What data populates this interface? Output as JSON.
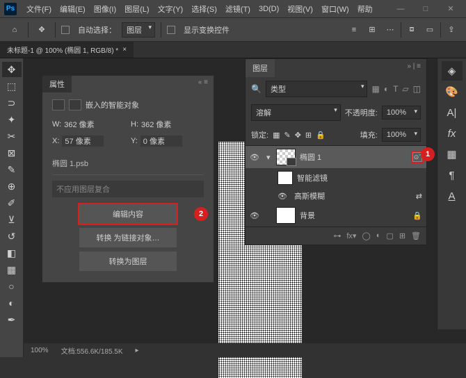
{
  "menu": [
    "文件(F)",
    "编辑(E)",
    "图像(I)",
    "图层(L)",
    "文字(Y)",
    "选择(S)",
    "滤镜(T)",
    "3D(D)",
    "视图(V)",
    "窗口(W)",
    "帮助"
  ],
  "optbar": {
    "auto_select": "自动选择：",
    "layer_dd": "图层",
    "show_transform": "显示变换控件"
  },
  "doc_tab": "未标题-1 @ 100% (椭圆 1, RGB/8) *",
  "props": {
    "title": "属性",
    "header": "嵌入的智能对象",
    "w_label": "W:",
    "w_val": "362 像素",
    "h_label": "H:",
    "h_val": "362 像素",
    "x_label": "X:",
    "x_val": "57 像素",
    "y_label": "Y:",
    "y_val": "0 像素",
    "file": "椭圆 1.psb",
    "comp": "不应用图层复合",
    "btn_edit": "编辑内容",
    "btn_link": "转换 为链接对象…",
    "btn_layer": "转换为图层"
  },
  "layers": {
    "title": "图层",
    "type_dd": "类型",
    "blend": "溶解",
    "opacity_label": "不透明度:",
    "opacity": "100%",
    "lock_label": "锁定:",
    "fill_label": "填充:",
    "fill": "100%",
    "item1": "椭圆 1",
    "smart": "智能滤镜",
    "gauss": "高斯模糊",
    "bg": "背景"
  },
  "status": {
    "zoom": "100%",
    "doc": "文档:556.6K/185.5K"
  },
  "badge1": "1",
  "badge2": "2"
}
